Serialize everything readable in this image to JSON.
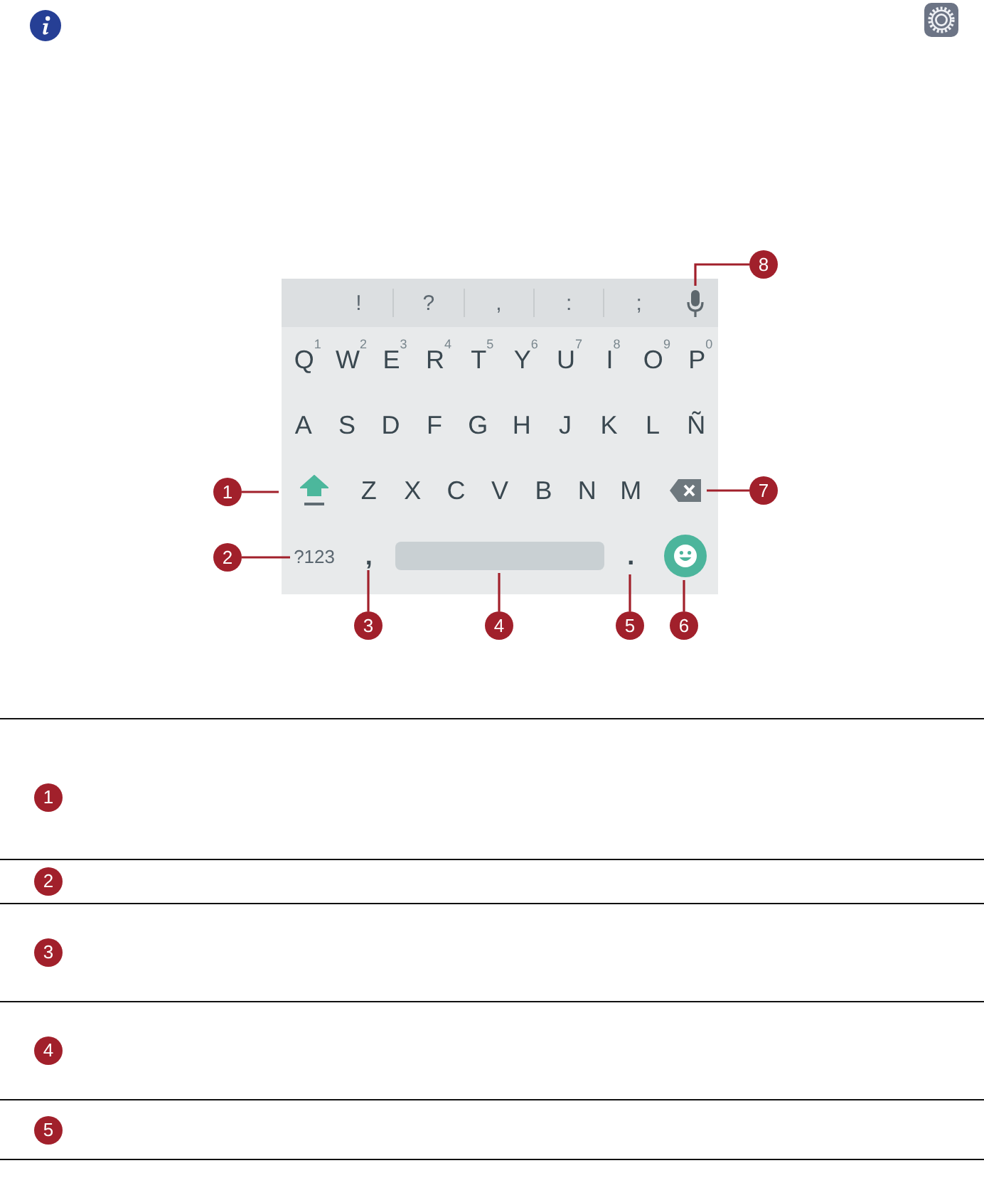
{
  "keyboard": {
    "suggestions": [
      "!",
      "?",
      ",",
      ":",
      ";"
    ],
    "rows": [
      [
        {
          "kind": "letter",
          "label": "Q",
          "hint": "1"
        },
        {
          "kind": "letter",
          "label": "W",
          "hint": "2"
        },
        {
          "kind": "letter",
          "label": "E",
          "hint": "3"
        },
        {
          "kind": "letter",
          "label": "R",
          "hint": "4"
        },
        {
          "kind": "letter",
          "label": "T",
          "hint": "5"
        },
        {
          "kind": "letter",
          "label": "Y",
          "hint": "6"
        },
        {
          "kind": "letter",
          "label": "U",
          "hint": "7"
        },
        {
          "kind": "letter",
          "label": "I",
          "hint": "8"
        },
        {
          "kind": "letter",
          "label": "O",
          "hint": "9"
        },
        {
          "kind": "letter",
          "label": "P",
          "hint": "0"
        }
      ],
      [
        {
          "kind": "letter",
          "label": "A"
        },
        {
          "kind": "letter",
          "label": "S"
        },
        {
          "kind": "letter",
          "label": "D"
        },
        {
          "kind": "letter",
          "label": "F"
        },
        {
          "kind": "letter",
          "label": "G"
        },
        {
          "kind": "letter",
          "label": "H"
        },
        {
          "kind": "letter",
          "label": "J"
        },
        {
          "kind": "letter",
          "label": "K"
        },
        {
          "kind": "letter",
          "label": "L"
        },
        {
          "kind": "letter",
          "label": "Ñ"
        }
      ],
      [
        {
          "kind": "shift",
          "on": true
        },
        {
          "kind": "letter",
          "label": "Z"
        },
        {
          "kind": "letter",
          "label": "X"
        },
        {
          "kind": "letter",
          "label": "C"
        },
        {
          "kind": "letter",
          "label": "V"
        },
        {
          "kind": "letter",
          "label": "B"
        },
        {
          "kind": "letter",
          "label": "N"
        },
        {
          "kind": "letter",
          "label": "M"
        },
        {
          "kind": "backspace"
        }
      ],
      [
        {
          "kind": "symbols",
          "label": "?123"
        },
        {
          "kind": "punct",
          "label": ","
        },
        {
          "kind": "space"
        },
        {
          "kind": "punct",
          "label": "."
        },
        {
          "kind": "emoji"
        }
      ]
    ]
  },
  "callouts": [
    {
      "number": "1"
    },
    {
      "number": "2"
    },
    {
      "number": "3"
    },
    {
      "number": "4"
    },
    {
      "number": "5"
    },
    {
      "number": "6"
    },
    {
      "number": "7"
    },
    {
      "number": "8"
    }
  ],
  "legend": [
    {
      "number": "1"
    },
    {
      "number": "2"
    },
    {
      "number": "3"
    },
    {
      "number": "4"
    },
    {
      "number": "5"
    }
  ]
}
